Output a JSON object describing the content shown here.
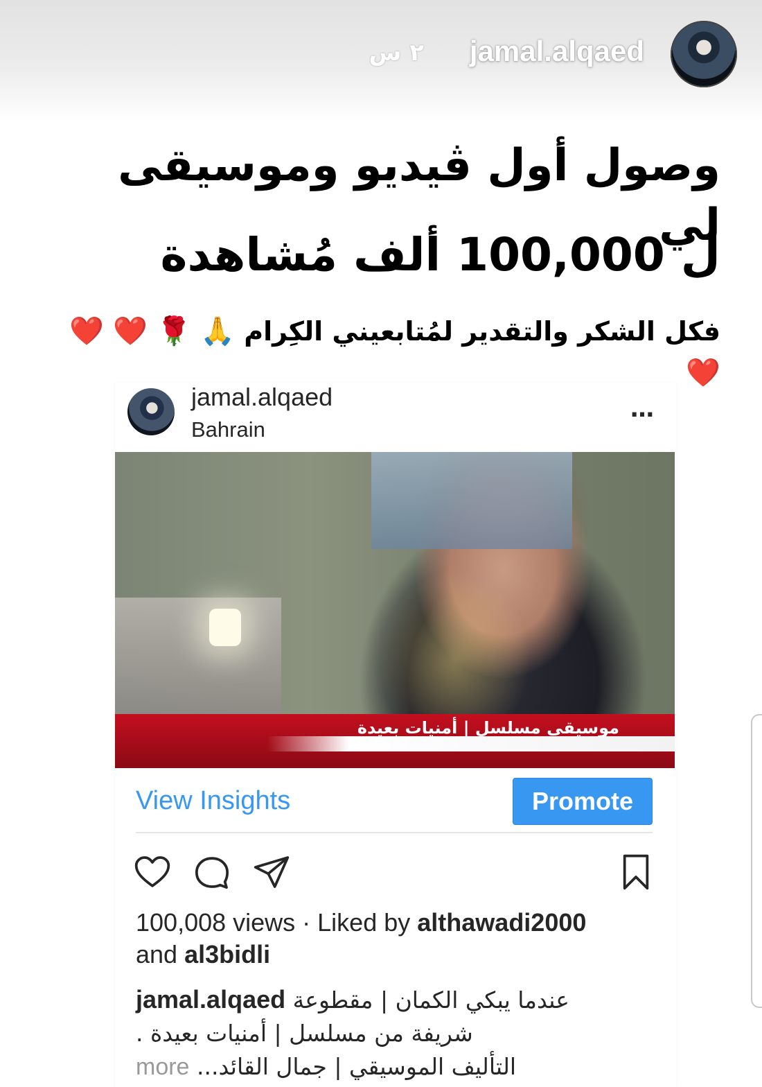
{
  "story": {
    "username": "jamal.alqaed",
    "time_ago": "٢ س",
    "headline_line1": "وصول أول ڤيديو وموسيقى لي",
    "headline_line2": "ل 100,000 ألف مُشاهدة",
    "thanks_line": "فكل الشكر والتقدير لمُتابعيني الكِرام",
    "emojis": [
      "🙏",
      "🌹",
      "❤️",
      "❤️",
      "❤️"
    ]
  },
  "post": {
    "username": "jamal.alqaed",
    "location": "Bahrain",
    "more_icon": "…",
    "video_caption": "موسيقى مسلسل | أمنيات بعيدة",
    "view_insights_label": "View Insights",
    "promote_label": "Promote",
    "views": "100,008 views",
    "liked_by_prefix": "· Liked by",
    "liked_by_user": "althawadi2000",
    "and_label": "and",
    "other_user": "al3bidli",
    "caption_user": "jamal.alqaed",
    "caption_line1": "عندما يبكي الكمان | مقطوعة",
    "caption_line2": "شريفة من مسلسل | أمنيات بعيدة .",
    "caption_line3": "التأليف الموسيقي | جمال القائد...",
    "more_label": "more"
  },
  "icons": {
    "like": "heart-icon",
    "comment": "comment-icon",
    "share": "send-icon",
    "save": "bookmark-icon"
  },
  "colors": {
    "accent": "#3897f0",
    "text": "#262626",
    "muted": "#999999",
    "banner_red": "#c40f1f"
  }
}
